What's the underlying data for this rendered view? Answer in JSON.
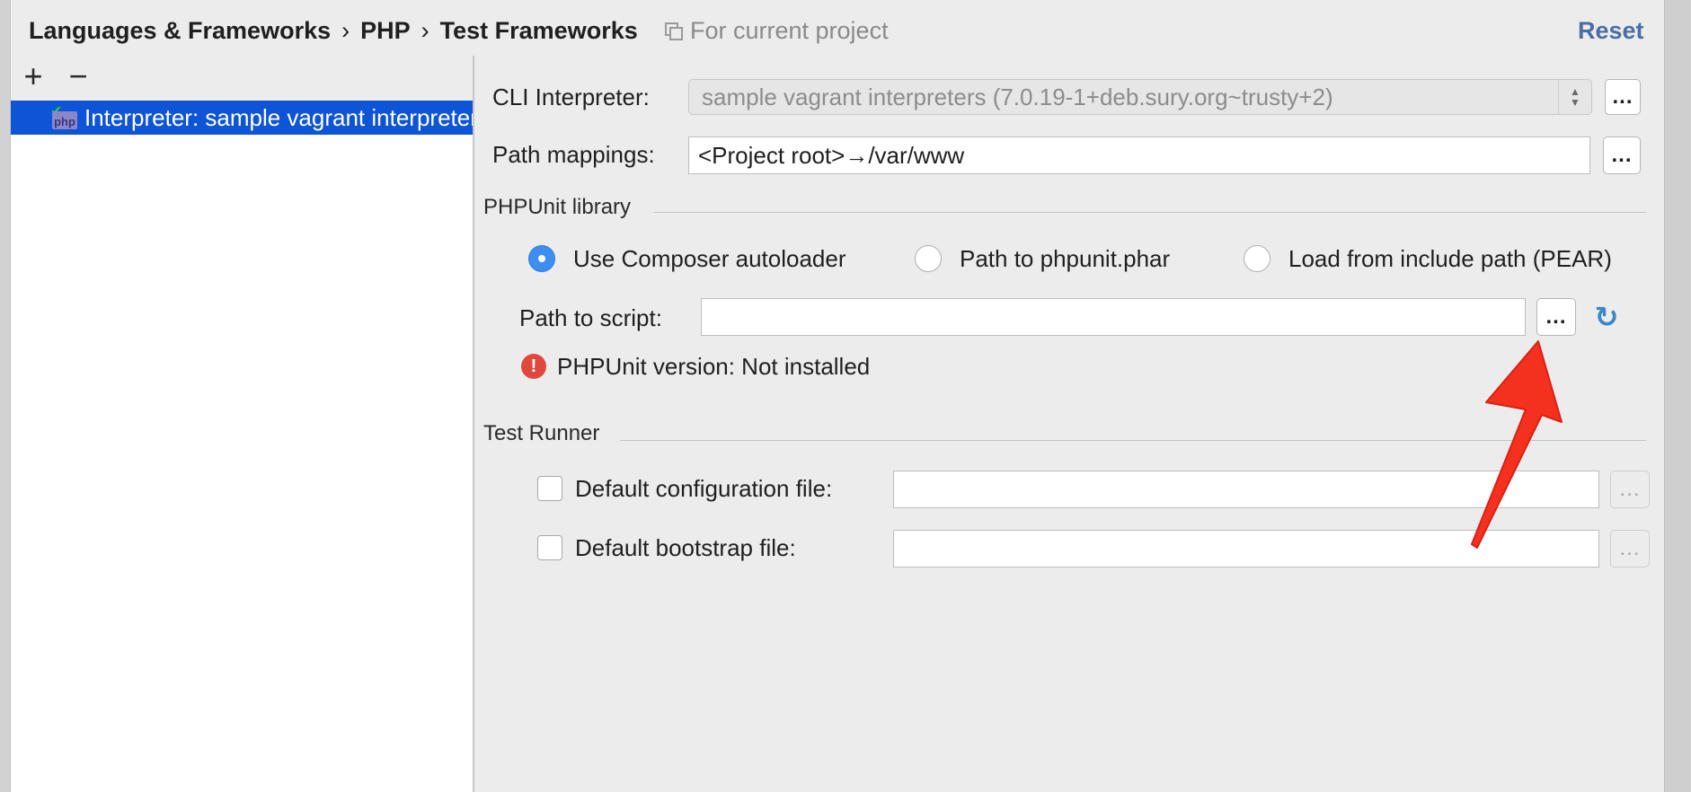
{
  "header": {
    "breadcrumb": [
      "Languages & Frameworks",
      "PHP",
      "Test Frameworks"
    ],
    "separator": "›",
    "scope_label": "For current project",
    "reset_label": "Reset"
  },
  "left_panel": {
    "add_label": "+",
    "remove_label": "−",
    "items": [
      {
        "label": "Interpreter: sample vagrant interpreters",
        "icon": "php-interpreter-icon",
        "selected": true
      }
    ]
  },
  "form": {
    "cli_interpreter_label": "CLI Interpreter:",
    "cli_interpreter_value": "sample vagrant interpreters (7.0.19-1+deb.sury.org~trusty+2)",
    "path_mappings_label": "Path mappings:",
    "path_mappings_value": "<Project root>→/var/www",
    "more_label": "...",
    "phpunit_section": "PHPUnit library",
    "radio_options": [
      {
        "label": "Use Composer autoloader",
        "selected": true
      },
      {
        "label": "Path to phpunit.phar",
        "selected": false
      },
      {
        "label": "Load from include path (PEAR)",
        "selected": false
      }
    ],
    "path_to_script_label": "Path to script:",
    "path_to_script_value": "",
    "phpunit_version": "PHPUnit version: Not installed",
    "test_runner_section": "Test Runner",
    "default_config_label": "Default configuration file:",
    "default_config_value": "",
    "default_bootstrap_label": "Default bootstrap file:",
    "default_bootstrap_value": "",
    "default_config_checked": false,
    "default_bootstrap_checked": false
  },
  "colors": {
    "selection": "#0d54d6",
    "link": "#4a6fa3",
    "radio_on": "#3d8ef0",
    "error": "#e0473d",
    "arrow": "#f4301e"
  }
}
